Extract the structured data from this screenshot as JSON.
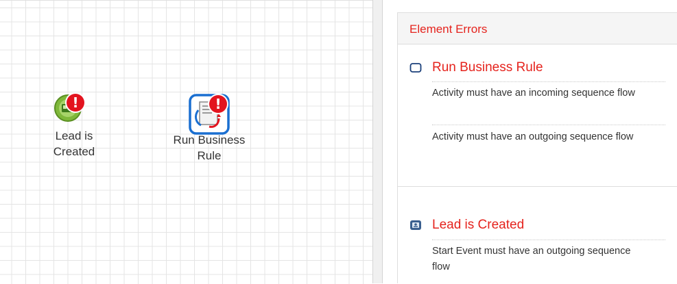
{
  "canvas": {
    "nodes": [
      {
        "label_line1": "Lead is",
        "label_line2": "Created",
        "kind": "start-event",
        "has_error": true
      },
      {
        "label_line1": "Run Business",
        "label_line2": "Rule",
        "kind": "business-rule-task",
        "has_error": true
      }
    ],
    "error_badge_glyph": "!"
  },
  "errors_panel": {
    "title": "Element Errors",
    "groups": [
      {
        "title": "Run Business Rule",
        "icon": "task-square-icon",
        "messages": [
          "Activity must have an incoming sequence flow",
          "Activity must have an outgoing sequence flow"
        ]
      },
      {
        "title": "Lead is Created",
        "icon": "start-event-icon",
        "messages": [
          "Start Event must have an outgoing sequence flow"
        ]
      }
    ]
  },
  "colors": {
    "error_red": "#e5231d",
    "badge_red": "#e3141f",
    "task_blue": "#1a6fd1",
    "start_green": "#6cab2a"
  }
}
